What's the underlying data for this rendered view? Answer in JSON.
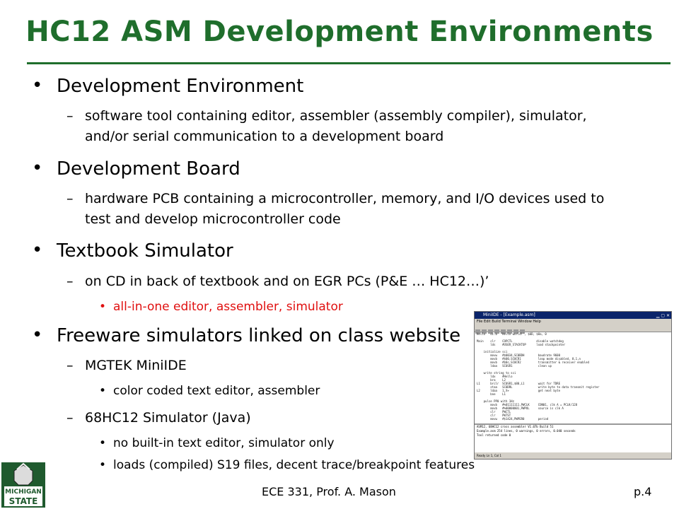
{
  "slide": {
    "title": "HC12 ASM Development Environments",
    "colors": {
      "title": "#1f6e2c",
      "highlight": "#e01010"
    },
    "bullets": [
      {
        "level": 1,
        "text": "Development Environment"
      },
      {
        "level": 2,
        "text": "software tool containing editor, assembler (assembly compiler), simulator, and/or serial communication to a development board"
      },
      {
        "level": 1,
        "text": "Development Board"
      },
      {
        "level": 2,
        "text": "hardware PCB containing a microcontroller, memory, and I/O devices used to test and develop microcontroller code"
      },
      {
        "level": 1,
        "text": "Textbook Simulator"
      },
      {
        "level": 2,
        "text": "on CD in back of textbook and on EGR PCs (P&E … HC12…)’"
      },
      {
        "level": 3,
        "text": "all-in-one editor, assembler, simulator",
        "color": "red"
      },
      {
        "level": 1,
        "text": "Freeware simulators linked on class website"
      },
      {
        "level": 2,
        "text": "MGTEK MiniIDE"
      },
      {
        "level": 3,
        "text": "color coded text editor, assembler"
      },
      {
        "level": 2,
        "text": "68HC12 Simulator (Java)"
      },
      {
        "level": 3,
        "text": "no built-in text editor, simulator only"
      },
      {
        "level": 3,
        "text": "loads (compiled) S19 files, decent trace/breakpoint features"
      }
    ],
    "markers": {
      "bullet": "•",
      "dash": "–"
    },
    "footer": {
      "center": "ECE 331, Prof. A. Mason",
      "page": "p.4"
    }
  },
  "screenshot": {
    "window_title": "MiniIDE - [Example.asm]",
    "menu": "File  Edit  Build  Terminal  Window  Help",
    "code_lines": [
      "Hello   dc.b  'Hello world!', $0D, $0a, 0",
      "",
      "Main    clr    COPCTL              disable watchdog",
      "        lds    #USER_STACKTOP      load stackpointer",
      "",
      "    initialize sci",
      "        movw   #$0034,SC0BDH        baudrate 9600",
      "        movb   #$00,SC0CR1          loop mode disabled, 8,1,n",
      "        movb   #$0c,SC0CR2          transmitter & receiver enabled",
      "        ldaa   SC0SR1               clean up",
      "",
      "    write string to sci",
      "        ldx    #Hello",
      "        bra    L2",
      "L1      brclr  SC0SR1,$80,L1        wait for TDRE",
      "        staa   SC0DRL               write byte to data transmit register",
      "L2      ldaa   1,X+                 get next byte",
      "        bne    L1",
      "",
      "    pulse PP0 with 1Hz",
      "        movb   #%01111111,PWCLK     CON01, clk A = PCLK/128",
      "        movb   #%00000001,PWPOL     source is clk A",
      "        clr    PWCTL",
      "        clr    PWTST",
      "        movw   #$1424,PWPER0        period"
    ],
    "output_lines": [
      "ASM12, 68HC12 cross assembler V1.07b Build 51",
      "Example.asm  254 lines, 0 warnings, 0 errors, 0.040 seconds",
      "",
      "Tool returned code  0"
    ],
    "status": "Ready                                  Ln 1, Col 1"
  },
  "logo": {
    "lines": [
      "MICHIGAN",
      "STATE"
    ]
  }
}
